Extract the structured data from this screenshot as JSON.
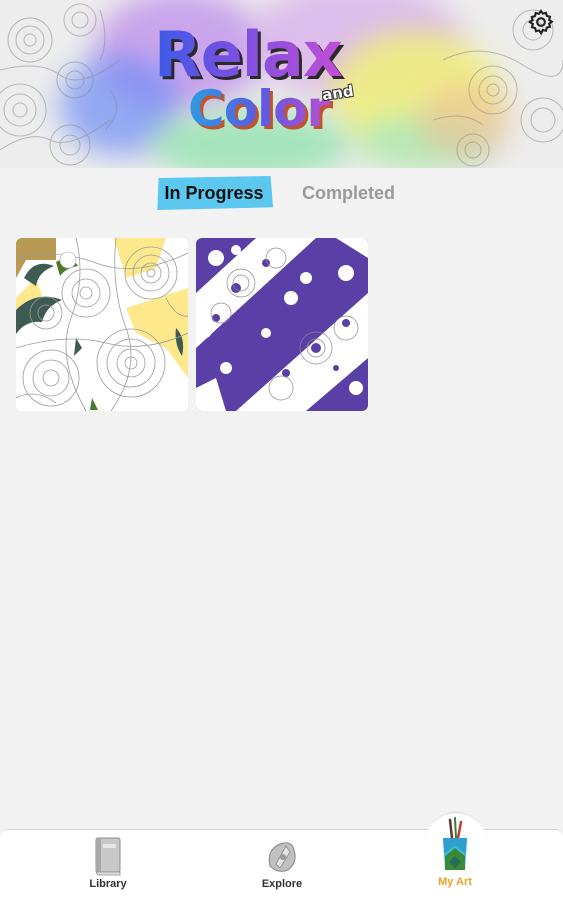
{
  "header": {
    "logo_line1": "Relax",
    "logo_and": "and",
    "logo_line2": "Color",
    "settings_icon": "gear-icon"
  },
  "tabs": [
    {
      "label": "In Progress",
      "selected": true
    },
    {
      "label": "Completed",
      "selected": false
    }
  ],
  "artworks": [
    {
      "name": "rose-coloring-page",
      "palette": [
        "#fde88c",
        "#3e5a52",
        "#b89a55",
        "#4a7a2a"
      ]
    },
    {
      "name": "floral-pattern-page",
      "palette": [
        "#5a3fa6"
      ]
    }
  ],
  "bottom_nav": {
    "items": [
      {
        "label": "Library",
        "icon": "book-icon",
        "selected": false
      },
      {
        "label": "Explore",
        "icon": "compass-icon",
        "selected": false
      },
      {
        "label": "My Art",
        "icon": "paintbrush-cup-icon",
        "selected": true
      }
    ],
    "accent_color": "#f0a020"
  },
  "colors": {
    "tab_highlight": "#5cc8ef",
    "background": "#f2f2f2",
    "art_purple": "#5a3fa6"
  }
}
